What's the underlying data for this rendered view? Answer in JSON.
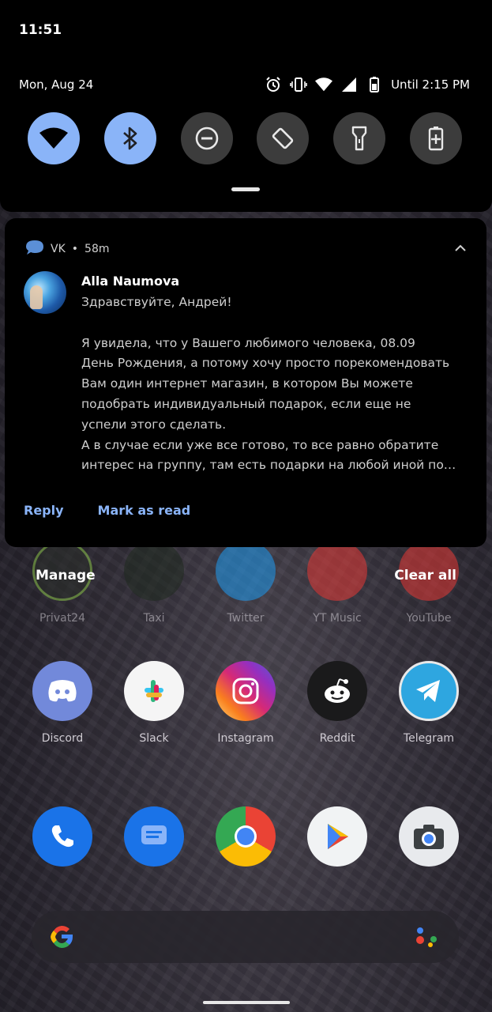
{
  "status_bar": {
    "time": "11:51"
  },
  "quick_settings": {
    "date": "Mon, Aug 24",
    "battery_text": "Until 2:15 PM",
    "tiles": [
      {
        "name": "wifi",
        "on": true
      },
      {
        "name": "bluetooth",
        "on": true
      },
      {
        "name": "do-not-disturb",
        "on": false
      },
      {
        "name": "auto-rotate",
        "on": false
      },
      {
        "name": "flashlight",
        "on": false
      },
      {
        "name": "battery-saver",
        "on": false
      }
    ]
  },
  "notification": {
    "app": "VK",
    "dot": "•",
    "time": "58m",
    "sender": "Alla Naumova",
    "message": "Здравствуйте, Андрей!\n\nЯ увидела, что у Вашего любимого человека, 08.09\nДень Рождения, а потому хочу просто порекомендовать\nВам один интернет магазин, в котором Вы можете\nподобрать индивидуальный подарок, если еще не\nуспели этого сделать.\nА в случае если уже все готово, то все равно обратите\nинтерес на группу, там есть подарки на любой иной по…",
    "actions": {
      "reply": "Reply",
      "mark_read": "Mark as read"
    }
  },
  "shade_actions": {
    "manage": "Manage",
    "clear_all": "Clear all"
  },
  "home": {
    "row1": [
      "Privat24",
      "Taxi",
      "Twitter",
      "YT Music",
      "YouTube"
    ],
    "row2": [
      "Discord",
      "Slack",
      "Instagram",
      "Reddit",
      "Telegram"
    ],
    "colors": {
      "accent": "#8ab4f8",
      "tile_off": "#3c3c3c"
    }
  }
}
